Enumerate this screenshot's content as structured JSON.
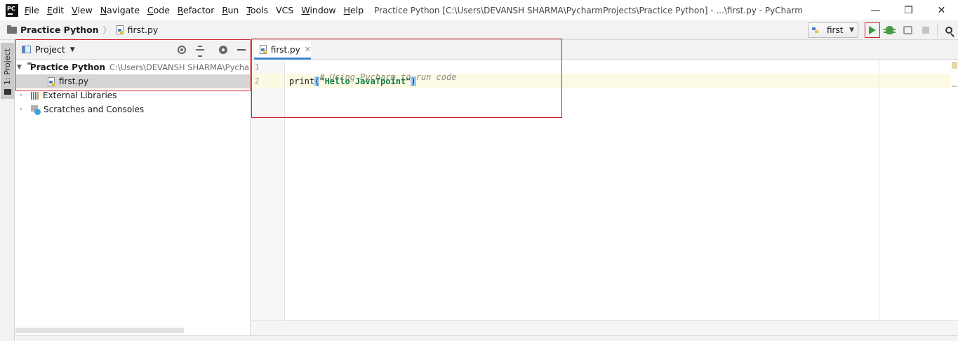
{
  "app": {
    "logo_text": "PC",
    "window_title": "Practice Python [C:\\Users\\DEVANSH SHARMA\\PycharmProjects\\Practice Python] - ...\\first.py - PyCharm"
  },
  "menu": {
    "items": [
      {
        "label": "File",
        "ul": "F",
        "rest": "ile"
      },
      {
        "label": "Edit",
        "ul": "E",
        "rest": "dit"
      },
      {
        "label": "View",
        "ul": "V",
        "rest": "iew"
      },
      {
        "label": "Navigate",
        "ul": "N",
        "rest": "avigate"
      },
      {
        "label": "Code",
        "ul": "C",
        "rest": "ode"
      },
      {
        "label": "Refactor",
        "ul": "R",
        "rest": "efactor"
      },
      {
        "label": "Run",
        "ul": "R",
        "rest": "un"
      },
      {
        "label": "Tools",
        "ul": "T",
        "rest": "ools"
      },
      {
        "label": "VCS",
        "ul": "",
        "rest": "VCS"
      },
      {
        "label": "Window",
        "ul": "W",
        "rest": "indow"
      },
      {
        "label": "Help",
        "ul": "H",
        "rest": "elp"
      }
    ]
  },
  "window_controls": {
    "minimize": "—",
    "restore": "❐",
    "close": "✕"
  },
  "navbar": {
    "project": "Practice Python",
    "file": "first.py",
    "separator": "〉",
    "run_config": "first"
  },
  "tool_strip": {
    "project_tab": "1: Project"
  },
  "project_panel": {
    "title": "Project",
    "tree": {
      "root_name": "Practice Python",
      "root_path": "C:\\Users\\DEVANSH SHARMA\\PycharmProjects\\Practice Python",
      "file": "first.py",
      "external_libraries": "External Libraries",
      "scratches": "Scratches and Consoles"
    }
  },
  "editor": {
    "tab_label": "first.py",
    "tab_close": "✕",
    "line_numbers": [
      "1",
      "2"
    ],
    "code": {
      "line1": "# Using Pycharm to run code",
      "line2_func": "print",
      "line2_open": "(",
      "line2_string": "\"Hello JavaTpoint\"",
      "line2_close": ")"
    }
  },
  "colors": {
    "highlight_red": "#d21f2c",
    "run_green": "#3e9a3e",
    "tab_underline": "#4083c9",
    "current_line": "#fcfae3"
  }
}
